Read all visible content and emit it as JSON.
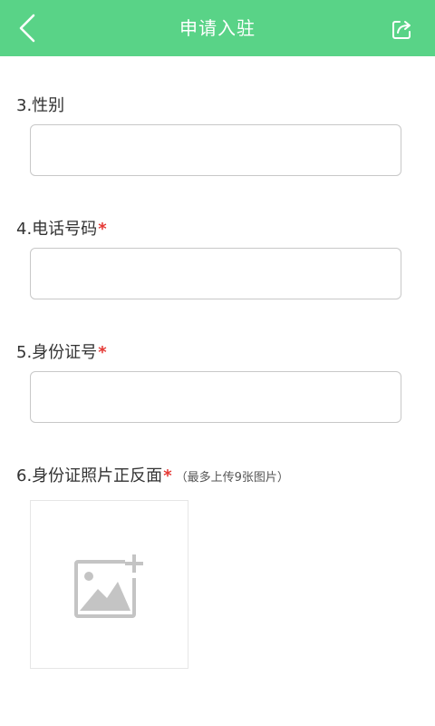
{
  "header": {
    "title": "申请入驻",
    "back_icon": "chevron-left-icon",
    "share_icon": "share-icon"
  },
  "form": {
    "gender": {
      "label": "3.性别",
      "value": ""
    },
    "phone": {
      "label": "4.电话号码",
      "required_mark": "*",
      "value": ""
    },
    "id_number": {
      "label": "5.身份证号",
      "required_mark": "*",
      "value": ""
    },
    "id_photos": {
      "label": "6.身份证照片正反面",
      "required_mark": "*",
      "hint": "（最多上传9张图片）",
      "upload_icon": "add-image-icon"
    }
  },
  "colors": {
    "header_bg": "#59d387",
    "required": "#e53935",
    "input_border": "#c8c8c8",
    "upload_icon": "#c4c4c4"
  }
}
